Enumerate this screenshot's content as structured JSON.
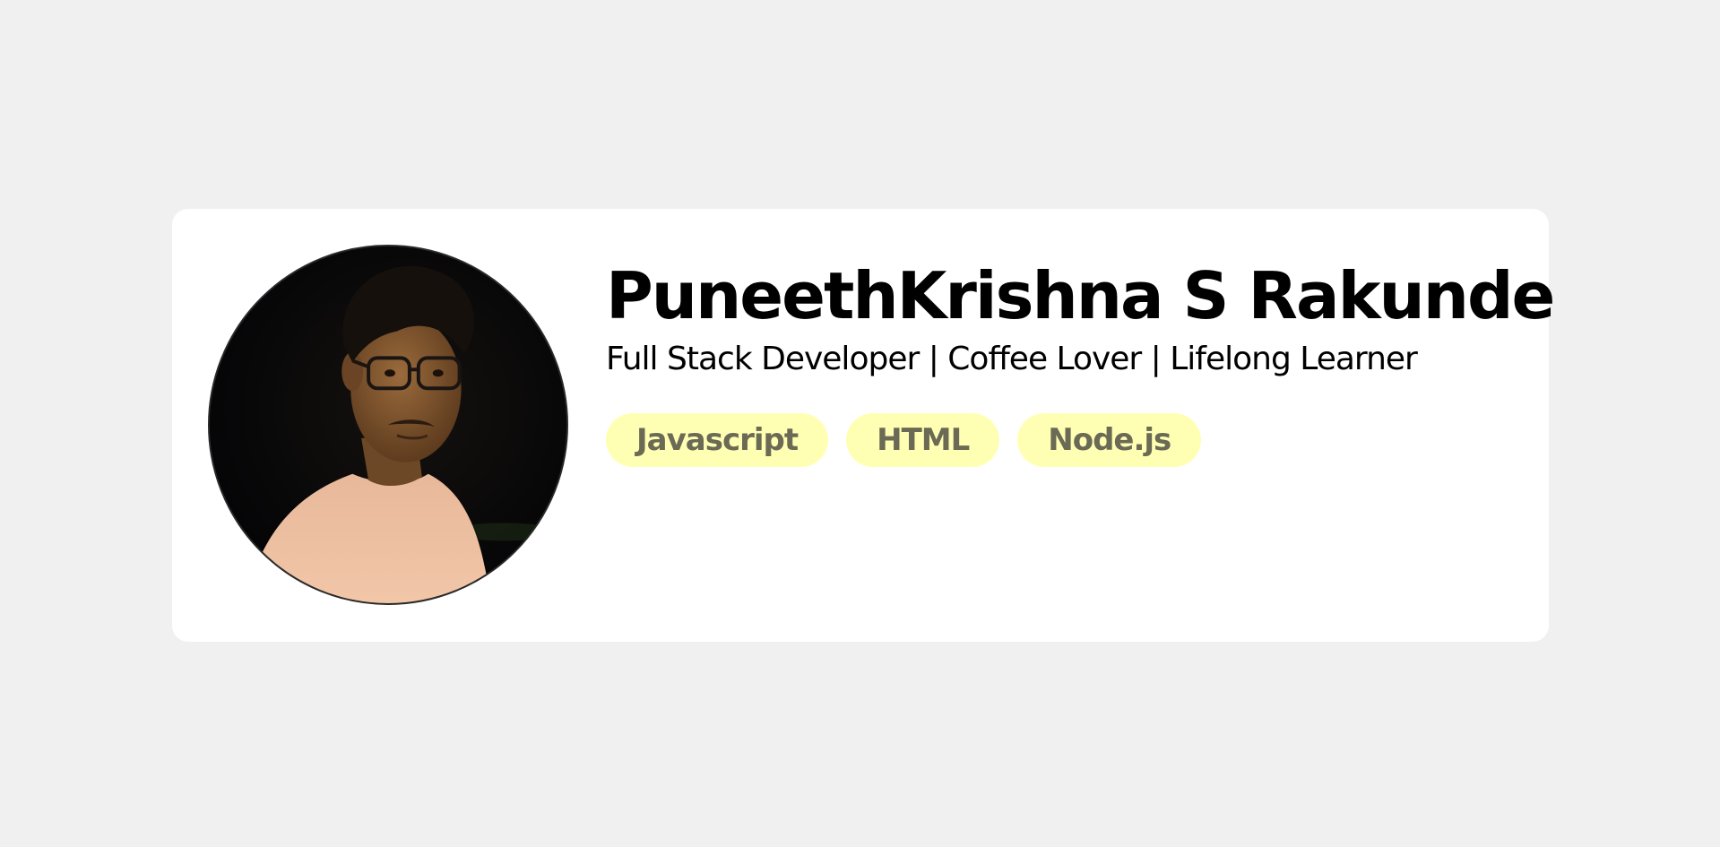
{
  "profile": {
    "name": "PuneethKrishna S Rakunde",
    "tagline": "Full Stack Developer | Coffee Lover | Lifelong Learner",
    "avatar_icon": "profile-photo",
    "skills": [
      "Javascript",
      "HTML",
      "Node.js"
    ]
  },
  "colors": {
    "page_background": "#f0f0f0",
    "card_background": "#ffffff",
    "tag_background": "#ffffb4",
    "tag_text": "#6a6a55"
  }
}
